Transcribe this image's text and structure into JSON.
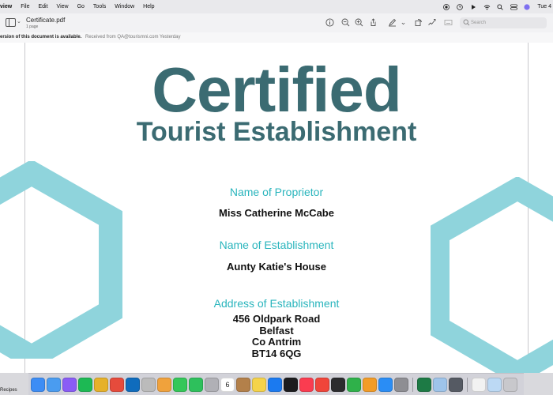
{
  "menubar": {
    "app_name": "view",
    "menus": [
      "File",
      "Edit",
      "View",
      "Go",
      "Tools",
      "Window",
      "Help"
    ],
    "clock": "Tue 4"
  },
  "toolbar": {
    "document_name": "Certificate.pdf",
    "page_count": "1 page",
    "search_placeholder": "Search"
  },
  "notice": {
    "message": "ersion of this document is available.",
    "received_from": "Received from QA@tourismni.com Yesterday"
  },
  "certificate": {
    "title": "Certified",
    "subtitle": "Tourist Establishment",
    "proprietor_label": "Name of Proprietor",
    "proprietor_value": "Miss Catherine McCabe",
    "establishment_label": "Name of Establishment",
    "establishment_value": "Aunty Katie's House",
    "address_label": "Address of Establishment",
    "address_lines": [
      "456 Oldpark Road",
      "Belfast",
      "Co Antrim",
      "BT14 6QG"
    ]
  },
  "dock": {
    "left_label": "Recipes",
    "calendar_date": "6",
    "apps": [
      {
        "name": "finder",
        "color": "#3d8df5"
      },
      {
        "name": "mail",
        "color": "#4a9cf0"
      },
      {
        "name": "messenger",
        "color": "#8a5cf6"
      },
      {
        "name": "spotify",
        "color": "#1db954"
      },
      {
        "name": "chrome-beta",
        "color": "#e6b12a"
      },
      {
        "name": "chrome",
        "color": "#e64b3c"
      },
      {
        "name": "outlook",
        "color": "#0f6cbd"
      },
      {
        "name": "app-store-safari",
        "color": "#bbbbbb"
      },
      {
        "name": "photos",
        "color": "#f0a23c"
      },
      {
        "name": "messages",
        "color": "#34c759"
      },
      {
        "name": "facetime",
        "color": "#2ec05c"
      },
      {
        "name": "app-gray",
        "color": "#b0b0b6"
      },
      {
        "name": "calendar",
        "color": "#ffffff"
      },
      {
        "name": "app-brown",
        "color": "#b3804a"
      },
      {
        "name": "notes",
        "color": "#f5d34a"
      },
      {
        "name": "app-blue",
        "color": "#1b7af0"
      },
      {
        "name": "tv",
        "color": "#1c1c1e"
      },
      {
        "name": "music",
        "color": "#fa3c50"
      },
      {
        "name": "news",
        "color": "#f0453a"
      },
      {
        "name": "app-dark",
        "color": "#2c2c2e"
      },
      {
        "name": "numbers",
        "color": "#2fb14a"
      },
      {
        "name": "pages",
        "color": "#f29c27"
      },
      {
        "name": "app-store",
        "color": "#2a8df5"
      },
      {
        "name": "system-settings",
        "color": "#8e8e93"
      },
      {
        "name": "excel",
        "color": "#1d7a45"
      },
      {
        "name": "preview",
        "color": "#9ec4ea"
      },
      {
        "name": "app-monitor",
        "color": "#555a63"
      },
      {
        "name": "document",
        "color": "#f2f2f2"
      },
      {
        "name": "folder",
        "color": "#bcd9f4"
      },
      {
        "name": "trash",
        "color": "#c8c8cc"
      }
    ]
  },
  "colors": {
    "title_color": "#3b6b72",
    "label_color": "#2ab5bd",
    "hexagon_color": "#8fd4dc"
  },
  "icons": [
    "sidebar-icon",
    "info-icon",
    "zoom-out-icon",
    "zoom-in-icon",
    "share-icon",
    "markup-pen-icon",
    "rotate-icon",
    "annotate-icon",
    "form-icon",
    "search-icon"
  ]
}
